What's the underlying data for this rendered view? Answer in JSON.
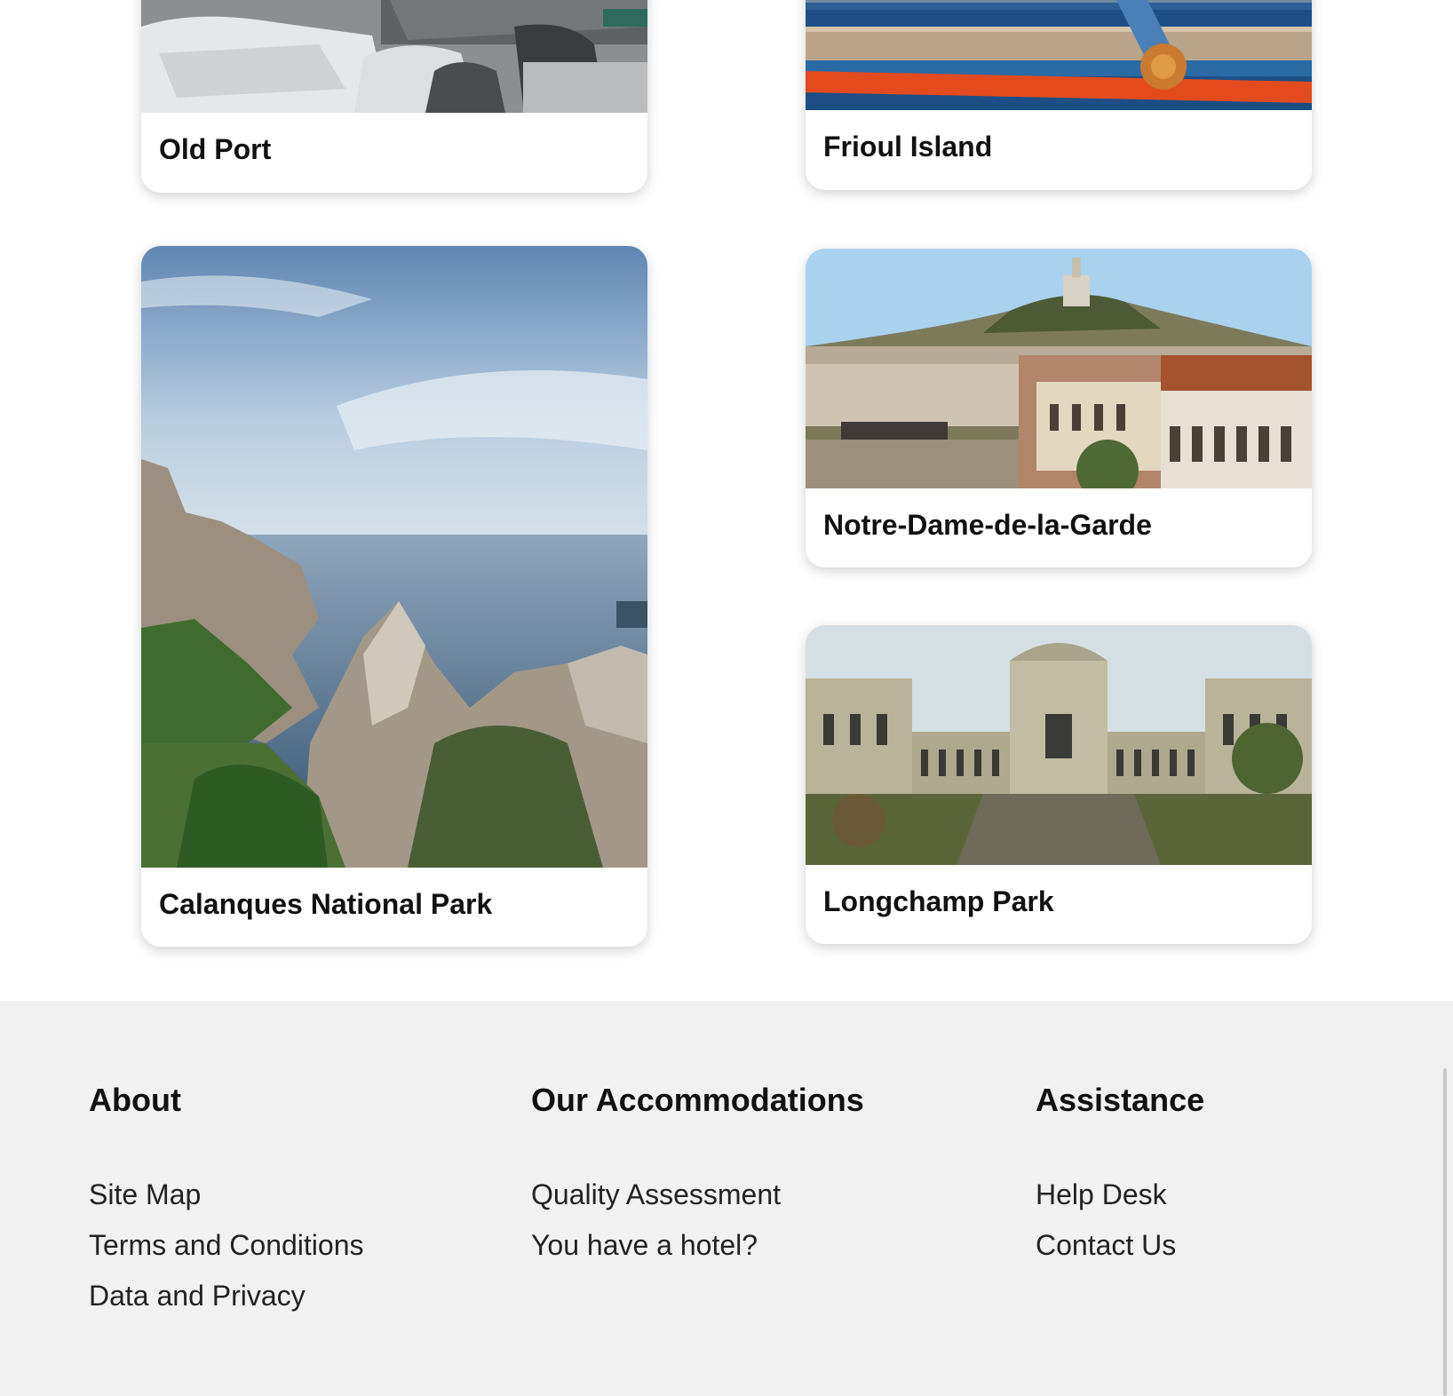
{
  "cards": [
    {
      "id": "old-port",
      "title": "Old Port"
    },
    {
      "id": "frioul-island",
      "title": "Frioul Island"
    },
    {
      "id": "calanques",
      "title": "Calanques National Park"
    },
    {
      "id": "notre-dame",
      "title": "Notre-Dame-de-la-Garde"
    },
    {
      "id": "longchamp",
      "title": "Longchamp Park"
    }
  ],
  "footer": {
    "about": {
      "heading": "About",
      "links": [
        "Site Map",
        "Terms and Conditions",
        "Data and Privacy"
      ]
    },
    "accommodations": {
      "heading": "Our Accommodations",
      "links": [
        "Quality Assessment",
        "You have a hotel?"
      ]
    },
    "assistance": {
      "heading": "Assistance",
      "links": [
        "Help Desk",
        "Contact Us"
      ]
    }
  }
}
